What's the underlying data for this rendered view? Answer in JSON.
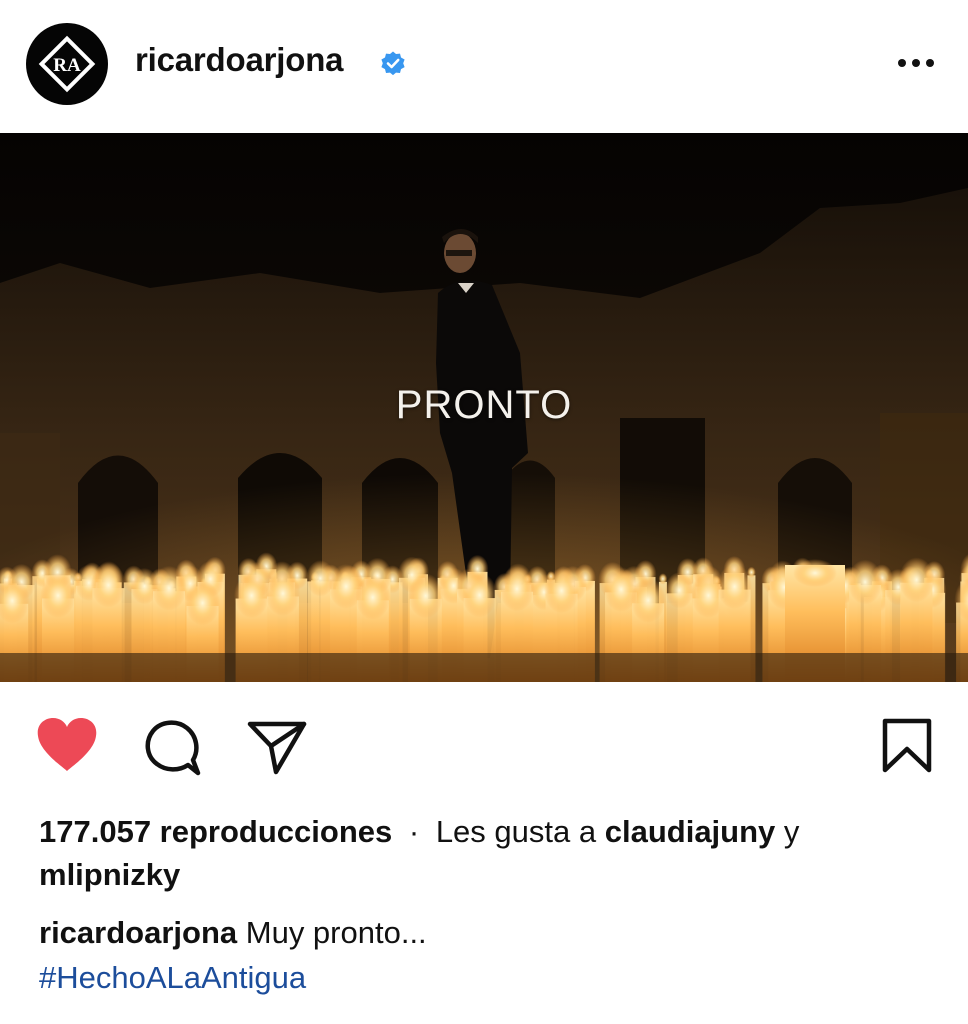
{
  "header": {
    "username": "ricardoarjona",
    "avatar_initials": "RA",
    "verified_icon": "verified-badge-icon",
    "more_icon": "more-options-icon",
    "verified_color": "#3897f0"
  },
  "media": {
    "overlay_text": "PRONTO",
    "description_icon": "video-post"
  },
  "actions": {
    "like_icon": "heart-filled-icon",
    "like_color": "#ed4956",
    "comment_icon": "comment-icon",
    "share_icon": "send-icon",
    "save_icon": "bookmark-icon"
  },
  "stats": {
    "views": "177.057 reproducciones",
    "separator": "·",
    "liked_by_prefix": "Les gusta a",
    "liked_by_user_1": "claudiajuny",
    "conjunction": "y",
    "liked_by_user_2": "mlipnizky"
  },
  "caption": {
    "username": "ricardoarjona",
    "text": "Muy pronto...",
    "hashtag": "#HechoALaAntigua"
  }
}
